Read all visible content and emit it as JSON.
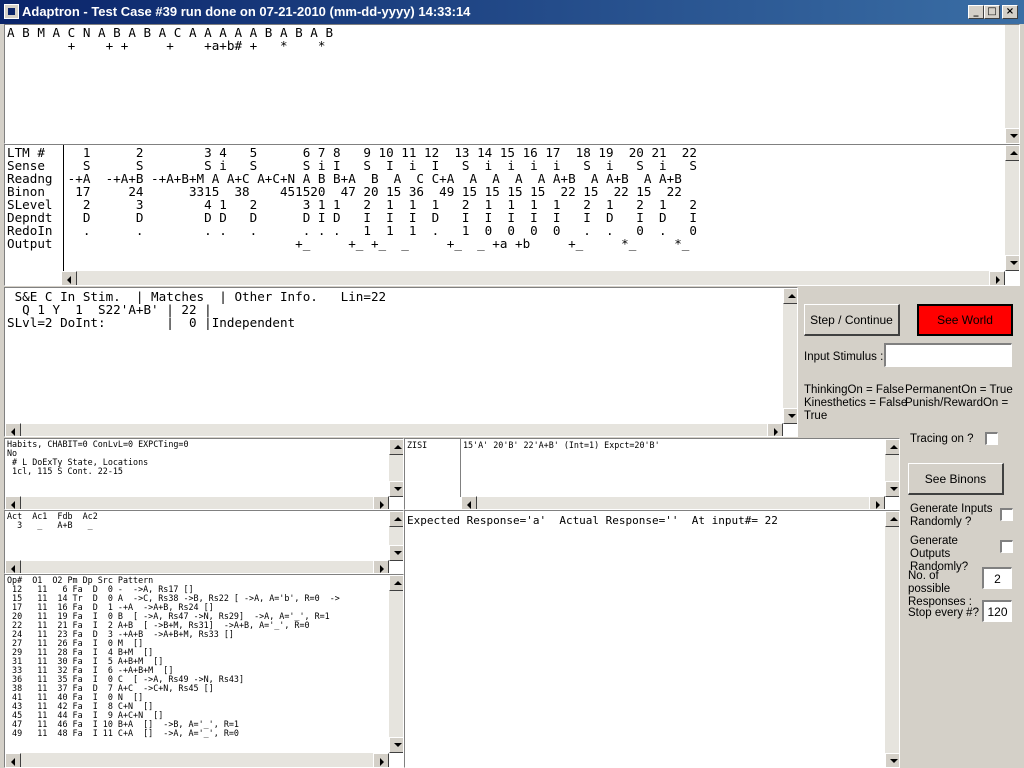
{
  "window": {
    "title": "Adaptron - Test Case #39 run done on 07-21-2010 (mm-dd-yyyy) 14:33:14",
    "min_glyph": "_",
    "max_glyph": "□",
    "close_glyph": "×"
  },
  "stimulus_panel": {
    "line1": "A B M A C N A B A B A C A A A A A B A B A B",
    "line2": "        +    + +     +    +a+b# +   *    *"
  },
  "ltm_panel": {
    "rows": [
      "LTM #     1      2        3 4   5      6 7 8   9 10 11 12  13 14 15 16 17  18 19  20 21  22",
      "Sense     S      S        S i   S      S i I   S  I  i  I   S  i  i  i  i   S  i   S  i   S",
      "Readng  -+A  -+A+B -+A+B+M A A+C A+C+N A B B+A  B  A  C C+A  A  A  A  A A+B  A A+B  A A+B",
      "Binon    17     24      3315  38    451520  47 20 15 36  49 15 15 15 15  22 15  22 15  22",
      "SLevel    2      3        4 1   2      3 1 1   2  1  1  1   2  1  1  1  1   2  1   2  1   2",
      "Depndt    D      D        D D   D      D I D   I  I  I  D   I  I  I  I  I   I  D   I  D   I",
      "RedoIn    .      .        . .   .      . . .   1  1  1  .   1  0  0  0  0   .  .   0  .   0",
      "Output                                +_     +_ +_  _     +_  _ +a +b     +_     *_     *_"
    ]
  },
  "se_panel": {
    "lines": [
      " S&E C In Stim.  | Matches  | Other Info.   Lin=22",
      "  Q 1 Y  1  S22'A+B' | 22 |",
      "SLvl=2 DoInt:        |  0 |Independent"
    ]
  },
  "habits_panel": {
    "lines": [
      "Habits, CHABIT=0 ConLvL=0 EXPCTing=0",
      "No",
      " # L DoExTy State, Locations",
      " 1cl, 115 S Cont. 22-15"
    ]
  },
  "zisi_panel": {
    "label": "ZISI",
    "text": "15'A' 20'B' 22'A+B' (Int=1) Expct=20'B'"
  },
  "act_panel": {
    "lines": [
      "Act  Ac1  Fdb  Ac2",
      "  3   _   A+B   _"
    ]
  },
  "response_panel": {
    "text": "Expected Response='a'  Actual Response=''  At input#= 22"
  },
  "op_panel": {
    "lines": [
      "Op#  O1  O2 Pm Dp Src Pattern",
      " 12   11   6 Fa  D  0 -  ->A, Rs17 []",
      " 15   11  14 Tr  D  0 A  ->C, Rs38 ->B, Rs22 [ ->A, A='b', R=0  ->",
      " 17   11  16 Fa  D  1 -+A  ->A+B, Rs24 []",
      " 20   11  19 Fa  I  0 B  [ ->A, Rs47 ->N, Rs29]  ->A, A='_', R=1",
      " 22   11  21 Fa  I  2 A+B  [ ->B+M, Rs31]  ->A+B, A='_', R=0",
      " 24   11  23 Fa  D  3 -+A+B  ->A+B+M, Rs33 []",
      " 27   11  26 Fa  I  0 M  []",
      " 29   11  28 Fa  I  4 B+M  []",
      " 31   11  30 Fa  I  5 A+B+M  []",
      " 33   11  32 Fa  I  6 -+A+B+M  []",
      " 36   11  35 Fa  I  0 C  [ ->A, Rs49 ->N, Rs43]",
      " 38   11  37 Fa  D  7 A+C  ->C+N, Rs45 []",
      " 41   11  40 Fa  I  0 N  []",
      " 43   11  42 Fa  I  8 C+N  []",
      " 45   11  44 Fa  I  9 A+C+N  []",
      " 47   11  46 Fa  I 10 B+A  []  ->B, A='_', R=1",
      " 49   11  48 Fa  I 11 C+A  []  ->A, A='_', R=0"
    ]
  },
  "controls": {
    "step_button": "Step / Continue",
    "see_world_button": "See World",
    "input_stimulus_label": "Input Stimulus :",
    "input_stimulus_value": "",
    "status_left": "ThinkingOn = False\nKinesthetics = False\nTrue",
    "status_right": "PermanentOn = True\nPunish/RewardOn =",
    "tracing_label": "Tracing on ?",
    "see_binons_button": "See Binons",
    "gen_inputs_label": "Generate Inputs Randomly ?",
    "gen_outputs_label": "Generate Outputs Randomly?",
    "num_responses_label": "No. of possible Responses :",
    "num_responses_value": "2",
    "stop_every_label": "Stop every #?",
    "stop_every_value": "120"
  },
  "colors": {
    "titlebar_start": "#0a246a",
    "titlebar_end": "#3a6ea5",
    "see_world_bg": "#ff0000",
    "window_bg": "#d4d0c8"
  }
}
